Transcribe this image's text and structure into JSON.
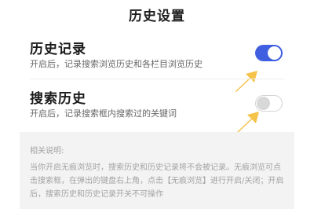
{
  "header": {
    "title": "历史设置"
  },
  "settings": [
    {
      "title": "历史记录",
      "description": "开启后，记录搜索浏览历史和各栏目浏览历史",
      "enabled": true
    },
    {
      "title": "搜索历史",
      "description": "开启后，记录搜索框内搜索过的关键词",
      "enabled": false
    }
  ],
  "note": {
    "heading": "相关说明:",
    "text": "当你开启无痕浏览时，搜索历史和历史记录将不会被记录。无痕浏览可点击搜索框，在弹出的键盘右上角，点击【无痕浏览】进行开启/关闭；开启后，搜索历史和历史记录开关不可操作"
  },
  "colors": {
    "toggle_on": "#3f5fe0",
    "toggle_off": "#d8d8d8",
    "arrow": "#f5c24a",
    "note_background": "#f3f3f3"
  },
  "icons": {
    "arrow": "yellow-pointer-arrow-icon"
  }
}
